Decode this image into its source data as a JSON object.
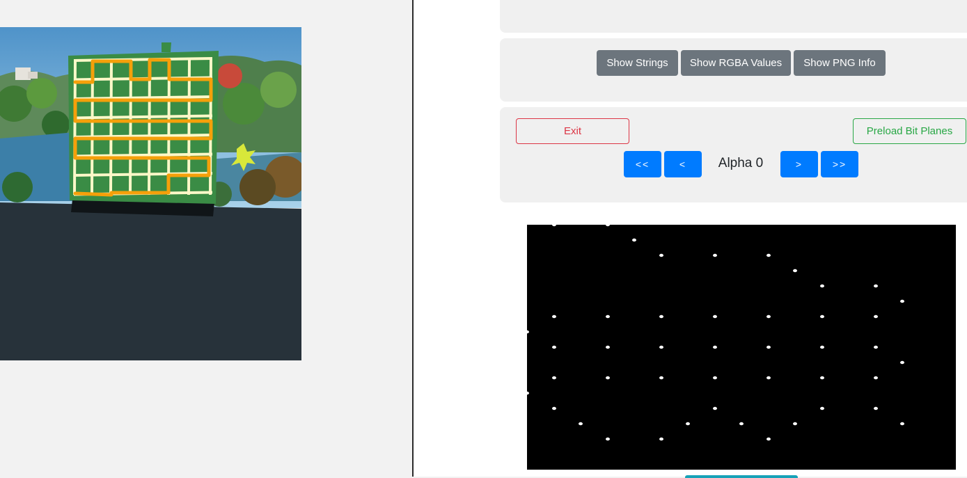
{
  "analysis_buttons": {
    "show_strings": "Show Strings",
    "show_rgba": "Show RGBA Values",
    "show_png_info": "Show PNG Info"
  },
  "navigation": {
    "exit_label": "Exit",
    "preload_label": "Preload Bit Planes",
    "first_label": "<<",
    "prev_label": "<",
    "next_label": ">",
    "last_label": ">>",
    "current_plane": "Alpha 0"
  },
  "colors": {
    "accent_blue": "#007bff",
    "teal": "#17a2b8",
    "gray_button": "#6c757d",
    "exit_red": "#dc3545",
    "preload_green": "#28a745",
    "puzzle_panel_green": "#3a8c45",
    "puzzle_grid_cream": "#fdf8c8",
    "puzzle_path_orange": "#f5a00a"
  },
  "images": {
    "game_screenshot": "puzzle-panel-scene",
    "bit_plane_view": "alpha-bit-plane-dots"
  }
}
